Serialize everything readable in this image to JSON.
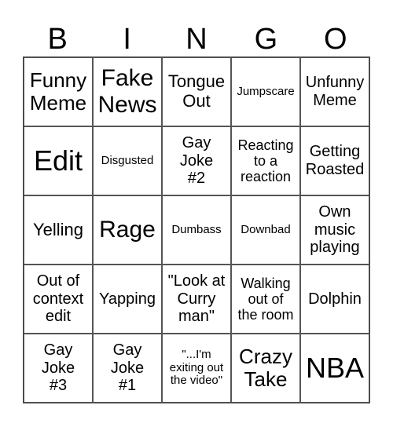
{
  "header": {
    "letters": [
      "B",
      "I",
      "N",
      "G",
      "O"
    ]
  },
  "board": {
    "rows": [
      [
        "Funny\nMeme",
        "Fake\nNews",
        "Tongue\nOut",
        "Jumpscare",
        "Unfunny\nMeme"
      ],
      [
        "Edit",
        "Disgusted",
        "Gay\nJoke\n#2",
        "Reacting\nto a\nreaction",
        "Getting\nRoasted"
      ],
      [
        "Yelling",
        "Rage",
        "Dumbass",
        "Downbad",
        "Own\nmusic\nplaying"
      ],
      [
        "Out of\ncontext\nedit",
        "Yapping",
        "\"Look at\nCurry\nman\"",
        "Walking\nout of\nthe room",
        "Dolphin"
      ],
      [
        "Gay\nJoke\n#3",
        "Gay\nJoke\n#1",
        "\"...I'm\nexiting out\nthe video\"",
        "Crazy\nTake",
        "NBA"
      ]
    ]
  }
}
